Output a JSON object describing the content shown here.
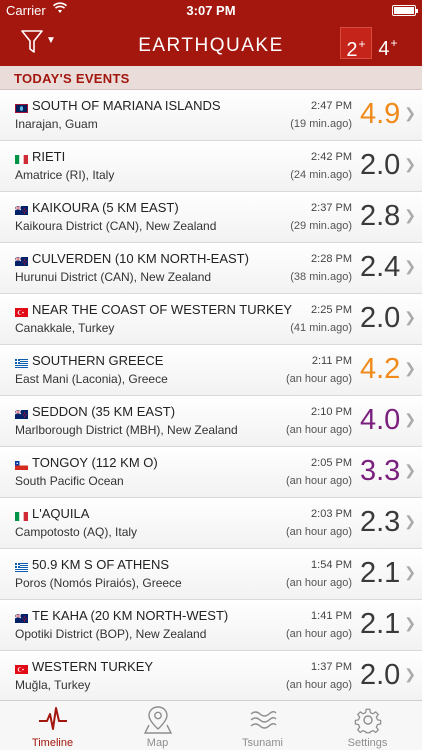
{
  "status_bar": {
    "carrier": "Carrier",
    "time": "3:07 PM"
  },
  "header": {
    "title": "EARTHQUAKE",
    "mag_filters": [
      {
        "value": "2",
        "sup": "+",
        "selected": true
      },
      {
        "value": "4",
        "sup": "+",
        "selected": false
      }
    ]
  },
  "section": {
    "title": "TODAY'S EVENTS"
  },
  "events": [
    {
      "flag": "guam",
      "place": "SOUTH OF MARIANA ISLANDS",
      "region": "Inarajan, Guam",
      "time": "2:47 PM",
      "ago": "(19 min.ago)",
      "mag": "4.9",
      "color": "orange"
    },
    {
      "flag": "italy",
      "place": "RIETI",
      "region": "Amatrice (RI), Italy",
      "time": "2:42 PM",
      "ago": "(24 min.ago)",
      "mag": "2.0",
      "color": "gray"
    },
    {
      "flag": "nz",
      "place": "KAIKOURA (5 KM EAST)",
      "region": "Kaikoura District (CAN), New Zealand",
      "time": "2:37 PM",
      "ago": "(29 min.ago)",
      "mag": "2.8",
      "color": "gray"
    },
    {
      "flag": "nz",
      "place": "CULVERDEN (10 KM NORTH-EAST)",
      "region": "Hurunui District (CAN), New Zealand",
      "time": "2:28 PM",
      "ago": "(38 min.ago)",
      "mag": "2.4",
      "color": "gray"
    },
    {
      "flag": "turkey",
      "place": "NEAR THE COAST OF WESTERN TURKEY",
      "region": "Canakkale, Turkey",
      "time": "2:25 PM",
      "ago": "(41 min.ago)",
      "mag": "2.0",
      "color": "gray"
    },
    {
      "flag": "greece",
      "place": "SOUTHERN GREECE",
      "region": "East Mani (Laconia), Greece",
      "time": "2:11 PM",
      "ago": "(an hour ago)",
      "mag": "4.2",
      "color": "orange"
    },
    {
      "flag": "nz",
      "place": "SEDDON (35 KM EAST)",
      "region": "Marlborough District (MBH), New Zealand",
      "time": "2:10 PM",
      "ago": "(an hour ago)",
      "mag": "4.0",
      "color": "purple"
    },
    {
      "flag": "chile",
      "place": "TONGOY (112 KM O)",
      "region": "South Pacific Ocean",
      "time": "2:05 PM",
      "ago": "(an hour ago)",
      "mag": "3.3",
      "color": "purple"
    },
    {
      "flag": "italy",
      "place": "L'AQUILA",
      "region": "Campotosto (AQ), Italy",
      "time": "2:03 PM",
      "ago": "(an hour ago)",
      "mag": "2.3",
      "color": "gray"
    },
    {
      "flag": "greece",
      "place": "50.9 KM S OF ATHENS",
      "region": "Poros (Nomós Piraiós), Greece",
      "time": "1:54 PM",
      "ago": "(an hour ago)",
      "mag": "2.1",
      "color": "gray"
    },
    {
      "flag": "nz",
      "place": "TE KAHA (20 KM NORTH-WEST)",
      "region": "Opotiki District (BOP), New Zealand",
      "time": "1:41 PM",
      "ago": "(an hour ago)",
      "mag": "2.1",
      "color": "gray"
    },
    {
      "flag": "turkey",
      "place": "WESTERN TURKEY",
      "region": "Muğla, Turkey",
      "time": "1:37 PM",
      "ago": "(an hour ago)",
      "mag": "2.0",
      "color": "gray"
    }
  ],
  "colors": {
    "brand": "#a3170f",
    "orange": "#f08a1a",
    "gray": "#3a3a3a",
    "purple": "#7a1f7e"
  },
  "tabs": [
    {
      "label": "Timeline",
      "icon": "heartbeat-icon",
      "active": true
    },
    {
      "label": "Map",
      "icon": "map-pin-icon",
      "active": false
    },
    {
      "label": "Tsunami",
      "icon": "waves-icon",
      "active": false
    },
    {
      "label": "Settings",
      "icon": "gear-icon",
      "active": false
    }
  ]
}
